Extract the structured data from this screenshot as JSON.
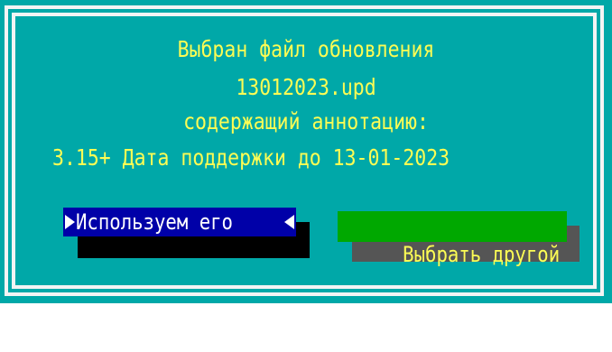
{
  "dialog": {
    "message_line1": "Выбран файл обновления",
    "message_line2": "13012023.upd",
    "message_line3": "содержащий аннотацию:",
    "message_line4": "3.15+ Дата поддержки до 13-01-2023"
  },
  "buttons": {
    "use_label": "Используем его",
    "choose_other_label": "Выбрать другой"
  },
  "colors": {
    "background": "#00a8a8",
    "text": "#fcfc54",
    "frame": "#f4f4f4",
    "button_selected_bg": "#0000a8",
    "button_selected_text": "#ffffff",
    "button_bg": "#00a800",
    "button_text": "#fcfc54"
  },
  "icons": {
    "selection_left": "arrow-right-icon",
    "selection_right": "arrow-left-icon"
  }
}
